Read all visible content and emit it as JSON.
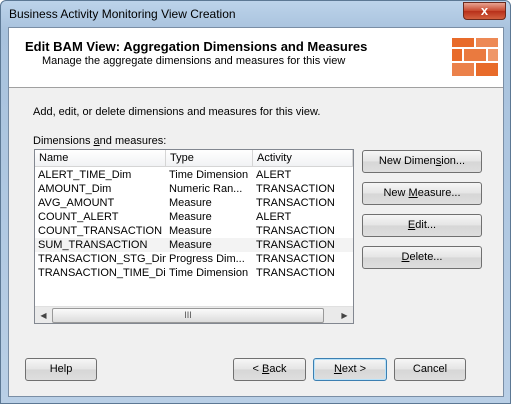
{
  "window": {
    "title": "Business Activity Monitoring View Creation",
    "close_glyph": "x"
  },
  "header": {
    "title": "Edit BAM View: Aggregation Dimensions and Measures",
    "subtitle": "Manage the aggregate dimensions and measures for this view"
  },
  "body": {
    "description": "Add, edit, or delete dimensions and measures for this view.",
    "list_label_pre": "Dimensions ",
    "list_label_mnemonic": "a",
    "list_label_post": "nd measures:"
  },
  "list": {
    "columns": [
      "Name",
      "Type",
      "Activity"
    ],
    "rows": [
      {
        "name": "ALERT_TIME_Dim",
        "type": "Time Dimension",
        "activity": "ALERT"
      },
      {
        "name": "AMOUNT_Dim",
        "type": "Numeric Ran...",
        "activity": "TRANSACTION"
      },
      {
        "name": "AVG_AMOUNT",
        "type": "Measure",
        "activity": "TRANSACTION"
      },
      {
        "name": "COUNT_ALERT",
        "type": "Measure",
        "activity": "ALERT"
      },
      {
        "name": "COUNT_TRANSACTION",
        "type": "Measure",
        "activity": "TRANSACTION"
      },
      {
        "name": "SUM_TRANSACTION",
        "type": "Measure",
        "activity": "TRANSACTION"
      },
      {
        "name": "TRANSACTION_STG_Dim",
        "type": "Progress Dim...",
        "activity": "TRANSACTION"
      },
      {
        "name": "TRANSACTION_TIME_Dim",
        "type": "Time Dimension",
        "activity": "TRANSACTION"
      }
    ],
    "scroll_left": "◀",
    "scroll_right": "▶",
    "thumb_grip": "III"
  },
  "buttons": {
    "new_dimension_pre": "New Dimen",
    "new_dimension_mn": "s",
    "new_dimension_post": "ion...",
    "new_measure_pre": "New ",
    "new_measure_mn": "M",
    "new_measure_post": "easure...",
    "edit_mn": "E",
    "edit_post": "dit...",
    "delete_mn": "D",
    "delete_post": "elete...",
    "help": "Help",
    "back_pre": "< ",
    "back_mn": "B",
    "back_post": "ack",
    "next_mn": "N",
    "next_post": "ext >",
    "cancel": "Cancel"
  }
}
